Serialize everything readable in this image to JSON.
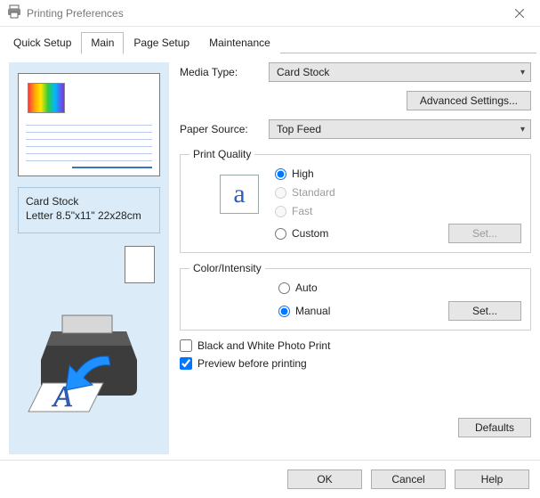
{
  "window": {
    "title": "Printing Preferences"
  },
  "tabs": {
    "quick_setup": "Quick Setup",
    "main": "Main",
    "page_setup": "Page Setup",
    "maintenance": "Maintenance",
    "active": "main"
  },
  "preview": {
    "media_type": "Card Stock",
    "paper_size": "Letter 8.5\"x11\" 22x28cm"
  },
  "media_type": {
    "label": "Media Type:",
    "value": "Card Stock"
  },
  "advanced_settings_label": "Advanced Settings...",
  "paper_source": {
    "label": "Paper Source:",
    "value": "Top Feed"
  },
  "print_quality": {
    "legend": "Print Quality",
    "options": {
      "high": "High",
      "standard": "Standard",
      "fast": "Fast",
      "custom": "Custom"
    },
    "selected": "high",
    "set_label": "Set..."
  },
  "color_intensity": {
    "legend": "Color/Intensity",
    "options": {
      "auto": "Auto",
      "manual": "Manual"
    },
    "selected": "manual",
    "set_label": "Set..."
  },
  "bw_photo": {
    "label": "Black and White Photo Print",
    "checked": false
  },
  "preview_before": {
    "label": "Preview before printing",
    "checked": true
  },
  "defaults_label": "Defaults",
  "buttons": {
    "ok": "OK",
    "cancel": "Cancel",
    "help": "Help"
  }
}
